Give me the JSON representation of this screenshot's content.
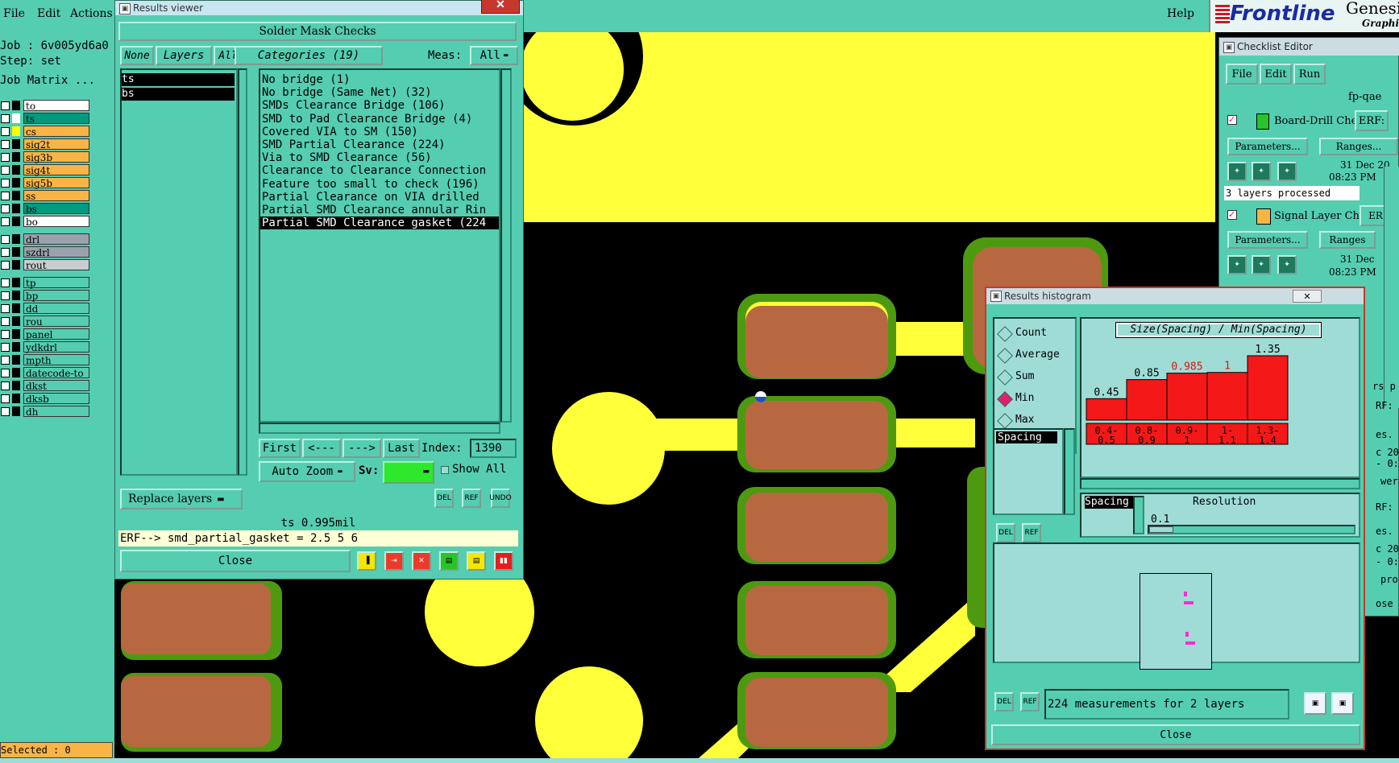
{
  "menubar": {
    "file": "File",
    "edit": "Edit",
    "actions": "Actions",
    "help": "Help"
  },
  "brand": {
    "logo": "Frontline",
    "product": "Genesi",
    "sub": "Graphic"
  },
  "sidebar": {
    "job": "Job : 6v005yd6a0",
    "step": "Step: set",
    "job_matrix": "Job Matrix ...",
    "selected": "Selected : 0",
    "layers": [
      {
        "name": "to",
        "color": "#ffffff",
        "swatch": "#000000"
      },
      {
        "name": "ts",
        "color": "#009a7e",
        "swatch": "#ffffff"
      },
      {
        "name": "cs",
        "color": "#f8b545",
        "swatch": "#ffff00"
      },
      {
        "name": "sig2t",
        "color": "#f8b545",
        "swatch": "#000000"
      },
      {
        "name": "sig3b",
        "color": "#f8b545",
        "swatch": "#000000"
      },
      {
        "name": "sig4t",
        "color": "#f8b545",
        "swatch": "#000000"
      },
      {
        "name": "sig5b",
        "color": "#f8b545",
        "swatch": "#000000"
      },
      {
        "name": "ss",
        "color": "#f8b545",
        "swatch": "#000000"
      },
      {
        "name": "bs",
        "color": "#009a7e",
        "swatch": "#000000"
      },
      {
        "name": "bo",
        "color": "#ffffff",
        "swatch": "#000000"
      },
      {
        "name": "drl",
        "color": "#9aa3ad",
        "swatch": "#000000"
      },
      {
        "name": "szdrl",
        "color": "#9aa3ad",
        "swatch": "#000000"
      },
      {
        "name": "rout",
        "color": "#c9cdd0",
        "swatch": "#000000"
      },
      {
        "name": "tp",
        "color": "#55cdb0",
        "swatch": "#000000"
      },
      {
        "name": "bp",
        "color": "#55cdb0",
        "swatch": "#000000"
      },
      {
        "name": "dd",
        "color": "#55cdb0",
        "swatch": "#000000"
      },
      {
        "name": "rou",
        "color": "#55cdb0",
        "swatch": "#000000"
      },
      {
        "name": "panel",
        "color": "#55cdb0",
        "swatch": "#000000"
      },
      {
        "name": "ydkdrl",
        "color": "#55cdb0",
        "swatch": "#000000"
      },
      {
        "name": "mpth",
        "color": "#55cdb0",
        "swatch": "#000000"
      },
      {
        "name": "datecode-to",
        "color": "#55cdb0",
        "swatch": "#000000"
      },
      {
        "name": "dkst",
        "color": "#55cdb0",
        "swatch": "#000000"
      },
      {
        "name": "dksb",
        "color": "#55cdb0",
        "swatch": "#000000"
      },
      {
        "name": "dh",
        "color": "#55cdb0",
        "swatch": "#000000"
      }
    ]
  },
  "results_viewer": {
    "title": "Results viewer",
    "header": "Solder Mask Checks",
    "none_btn": "None",
    "layers_btn": "Layers",
    "all_btn": "All",
    "categories_btn": "Categories (19)",
    "meas_label": "Meas:",
    "meas_value": "All",
    "layer_list": [
      "ts",
      "bs"
    ],
    "categories": [
      "No bridge (1)",
      "No bridge (Same Net) (32)",
      "SMDs Clearance Bridge (106)",
      "SMD to Pad Clearance Bridge (4)",
      "Covered VIA to SM (150)",
      "SMD Partial Clearance (224)",
      "Via to SMD Clearance (56)",
      "Clearance to Clearance Connection",
      "Feature too small to check (196)",
      "Partial Clearance on VIA drilled",
      "Partial SMD Clearance annular Rin",
      "Partial SMD Clearance gasket (224"
    ],
    "first": "First",
    "prev": "<---",
    "next": "--->",
    "last": "Last",
    "index_label": "Index:",
    "index_value": "1390",
    "auto_zoom": "Auto Zoom",
    "sv_label": "Sv:",
    "show_all": "Show All",
    "replace_layers": "Replace layers",
    "del": "DEL",
    "ref": "REF",
    "undo": "UNDO",
    "status": "ts 0.995mil",
    "erf": "ERF--> smd_partial_gasket = 2.5 5 6",
    "close": "Close"
  },
  "checklist": {
    "title": "Checklist Editor",
    "file": "File",
    "edit": "Edit",
    "run": "Run",
    "name": "fp-qae",
    "item1": "Board-Drill Che",
    "item2": "Signal Layer Ch",
    "erf": "ERF:",
    "er": "ER",
    "parameters": "Parameters...",
    "ranges": "Ranges...",
    "ranges2": "Ranges",
    "date1": "31 Dec 20",
    "time1": "08:23 PM",
    "date2": "31 Dec",
    "time2": "08:23 PM",
    "processed": "3 layers processed",
    "edge": [
      "rs p",
      "RF:",
      "es.",
      "c 20",
      "- 0:",
      "wer",
      "RF:",
      "es.",
      "c 20",
      "- 0:",
      "pro",
      "ose"
    ]
  },
  "histogram": {
    "title": "Results histogram",
    "radios": [
      {
        "label": "Count",
        "selected": false
      },
      {
        "label": "Average",
        "selected": false
      },
      {
        "label": "Sum",
        "selected": false
      },
      {
        "label": "Min",
        "selected": true
      },
      {
        "label": "Max",
        "selected": false
      }
    ],
    "list_item": "Spacing",
    "axis_item": "Spacing",
    "resolution_label": "Resolution",
    "resolution_value": "0.1",
    "summary": "224 measurements for 2 layers",
    "close": "Close",
    "del": "DEL",
    "ref": "REF"
  },
  "chart_data": {
    "type": "bar",
    "title": "Size(Spacing) / Min(Spacing)",
    "categories": [
      "0.4-0.5",
      "0.8-0.9",
      "0.9-1",
      "1-1.1",
      "1.3-1.4"
    ],
    "cat_top": [
      "0.4-",
      "0.8-",
      "0.9-",
      "1-",
      "1.3-"
    ],
    "cat_bottom": [
      "0.5",
      "0.9",
      "1",
      "1.1",
      "1.4"
    ],
    "values": [
      0.45,
      0.85,
      0.985,
      1,
      1.35
    ],
    "value_labels": [
      "0.45",
      "0.85",
      "0.985",
      "1",
      "1.35"
    ],
    "highlight": [
      false,
      false,
      true,
      true,
      false
    ],
    "ylim": [
      0,
      1.35
    ],
    "bar_color": "#f51818",
    "highlight_label_color": "#e81010"
  }
}
